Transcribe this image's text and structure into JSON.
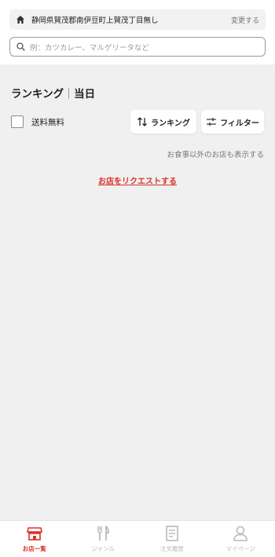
{
  "address": {
    "text": "静岡県賀茂郡南伊豆町上賀茂丁目無し",
    "change_label": "変更する",
    "icon": "home-icon"
  },
  "search": {
    "placeholder": "例：カツカレー、マルゲリータなど",
    "icon": "search-icon"
  },
  "ranking": {
    "title_main": "ランキング",
    "title_sub": "当日"
  },
  "filters": {
    "free_shipping_label": "送料無料",
    "free_shipping_checked": false,
    "rank_button_label": "ランキング",
    "filter_button_label": "フィルター"
  },
  "note": "お食事以外のお店も表示する",
  "request_link": "お店をリクエストする",
  "colors": {
    "accent": "#d9322a",
    "inactive": "#b9b9b9",
    "background": "#f0f0f0"
  },
  "bottom_nav": {
    "items": [
      {
        "label": "お店一覧",
        "icon": "store-icon",
        "active": true
      },
      {
        "label": "ジャンル",
        "icon": "cutlery-icon",
        "active": false
      },
      {
        "label": "注文履歴",
        "icon": "receipt-icon",
        "active": false
      },
      {
        "label": "マイページ",
        "icon": "person-icon",
        "active": false
      }
    ]
  }
}
